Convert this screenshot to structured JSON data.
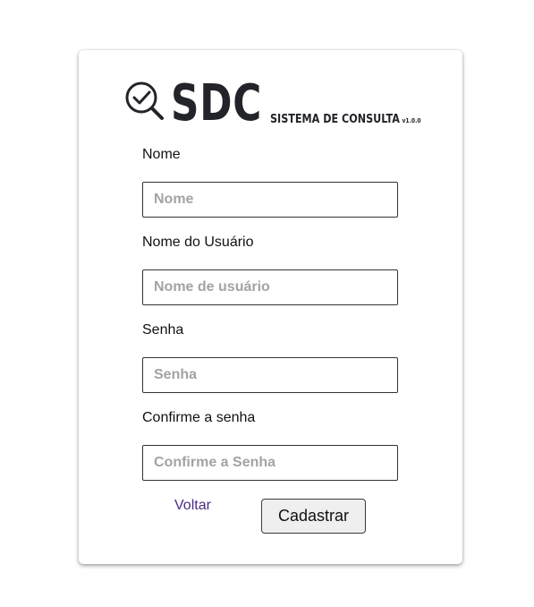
{
  "logo": {
    "title": "SDC",
    "subtitle": "SISTEMA DE CONSULTA",
    "version": "v1.0.0",
    "icon": "magnifier-check-icon"
  },
  "form": {
    "fields": [
      {
        "label": "Nome",
        "placeholder": "Nome",
        "value": ""
      },
      {
        "label": "Nome do Usuário",
        "placeholder": "Nome de usuário",
        "value": ""
      },
      {
        "label": "Senha",
        "placeholder": "Senha",
        "value": ""
      },
      {
        "label": "Confirme a senha",
        "placeholder": "Confirme a Senha",
        "value": ""
      }
    ],
    "back_label": "Voltar",
    "submit_label": "Cadastrar"
  },
  "colors": {
    "link": "#4a2b84",
    "logo": "#22242a",
    "placeholder": "#a3a3a3"
  }
}
